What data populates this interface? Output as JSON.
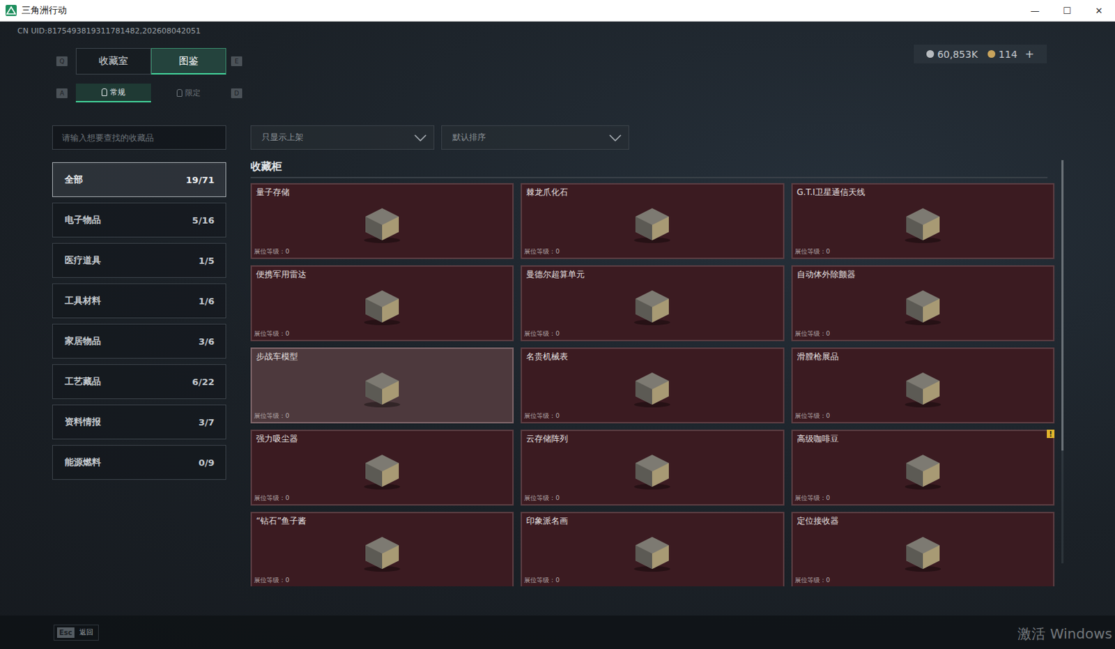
{
  "window": {
    "title": "三角洲行动",
    "controls": [
      "—",
      "☐",
      "✕"
    ]
  },
  "uid": "CN UID:8175493819311781482,202608042051",
  "currency": [
    {
      "amount": "60,853K",
      "color": "#b8bcc0",
      "add": ""
    },
    {
      "amount": "114",
      "color": "#c9a45c",
      "add": "+"
    }
  ],
  "main_tabs": {
    "prev_key": "Q",
    "next_key": "E",
    "items": [
      {
        "label": "收藏室",
        "selected": false
      },
      {
        "label": "图鉴",
        "selected": true
      }
    ]
  },
  "sub_tabs": {
    "prev_key": "A",
    "next_key": "D",
    "items": [
      {
        "label": "常规",
        "selected": true
      },
      {
        "label": "限定",
        "selected": false
      }
    ]
  },
  "search": {
    "placeholder": "请输入想要查找的收藏品"
  },
  "categories": [
    {
      "name": "全部",
      "count": "19/71",
      "selected": true
    },
    {
      "name": "电子物品",
      "count": "5/16",
      "selected": false
    },
    {
      "name": "医疗道具",
      "count": "1/5",
      "selected": false
    },
    {
      "name": "工具材料",
      "count": "1/6",
      "selected": false
    },
    {
      "name": "家居物品",
      "count": "3/6",
      "selected": false
    },
    {
      "name": "工艺藏品",
      "count": "6/22",
      "selected": false
    },
    {
      "name": "资料情报",
      "count": "3/7",
      "selected": false
    },
    {
      "name": "能源燃料",
      "count": "0/9",
      "selected": false
    }
  ],
  "filters": [
    {
      "label": "只显示上架"
    },
    {
      "label": "默认排序"
    }
  ],
  "section_title": "收藏柜",
  "items": [
    {
      "name": "量子存储",
      "level_label": "展位等级：0",
      "highlighted": false,
      "badge": ""
    },
    {
      "name": "棘龙爪化石",
      "level_label": "展位等级：0",
      "highlighted": false,
      "badge": ""
    },
    {
      "name": "G.T.I卫星通信天线",
      "level_label": "展位等级：0",
      "highlighted": false,
      "badge": ""
    },
    {
      "name": "便携军用雷达",
      "level_label": "展位等级：0",
      "highlighted": false,
      "badge": ""
    },
    {
      "name": "曼德尔超算单元",
      "level_label": "展位等级：0",
      "highlighted": false,
      "badge": ""
    },
    {
      "name": "自动体外除颤器",
      "level_label": "展位等级：0",
      "highlighted": false,
      "badge": ""
    },
    {
      "name": "步战车模型",
      "level_label": "展位等级：0",
      "highlighted": true,
      "badge": ""
    },
    {
      "name": "名贵机械表",
      "level_label": "展位等级：0",
      "highlighted": false,
      "badge": ""
    },
    {
      "name": "滑膛枪展品",
      "level_label": "展位等级：0",
      "highlighted": false,
      "badge": ""
    },
    {
      "name": "强力吸尘器",
      "level_label": "展位等级：0",
      "highlighted": false,
      "badge": ""
    },
    {
      "name": "云存储阵列",
      "level_label": "展位等级：0",
      "highlighted": false,
      "badge": ""
    },
    {
      "name": "高级咖啡豆",
      "level_label": "展位等级：0",
      "highlighted": false,
      "badge": "!"
    },
    {
      "name": "“钻石”鱼子酱",
      "level_label": "展位等级：0",
      "highlighted": false,
      "badge": ""
    },
    {
      "name": "印象派名画",
      "level_label": "展位等级：0",
      "highlighted": false,
      "badge": ""
    },
    {
      "name": "定位接收器",
      "level_label": "展位等级：0",
      "highlighted": false,
      "badge": ""
    }
  ],
  "scrollbar": {
    "level": 0.72
  },
  "footer": {
    "key": "Esc",
    "label": "返回"
  },
  "watermark": "激活 Windows"
}
